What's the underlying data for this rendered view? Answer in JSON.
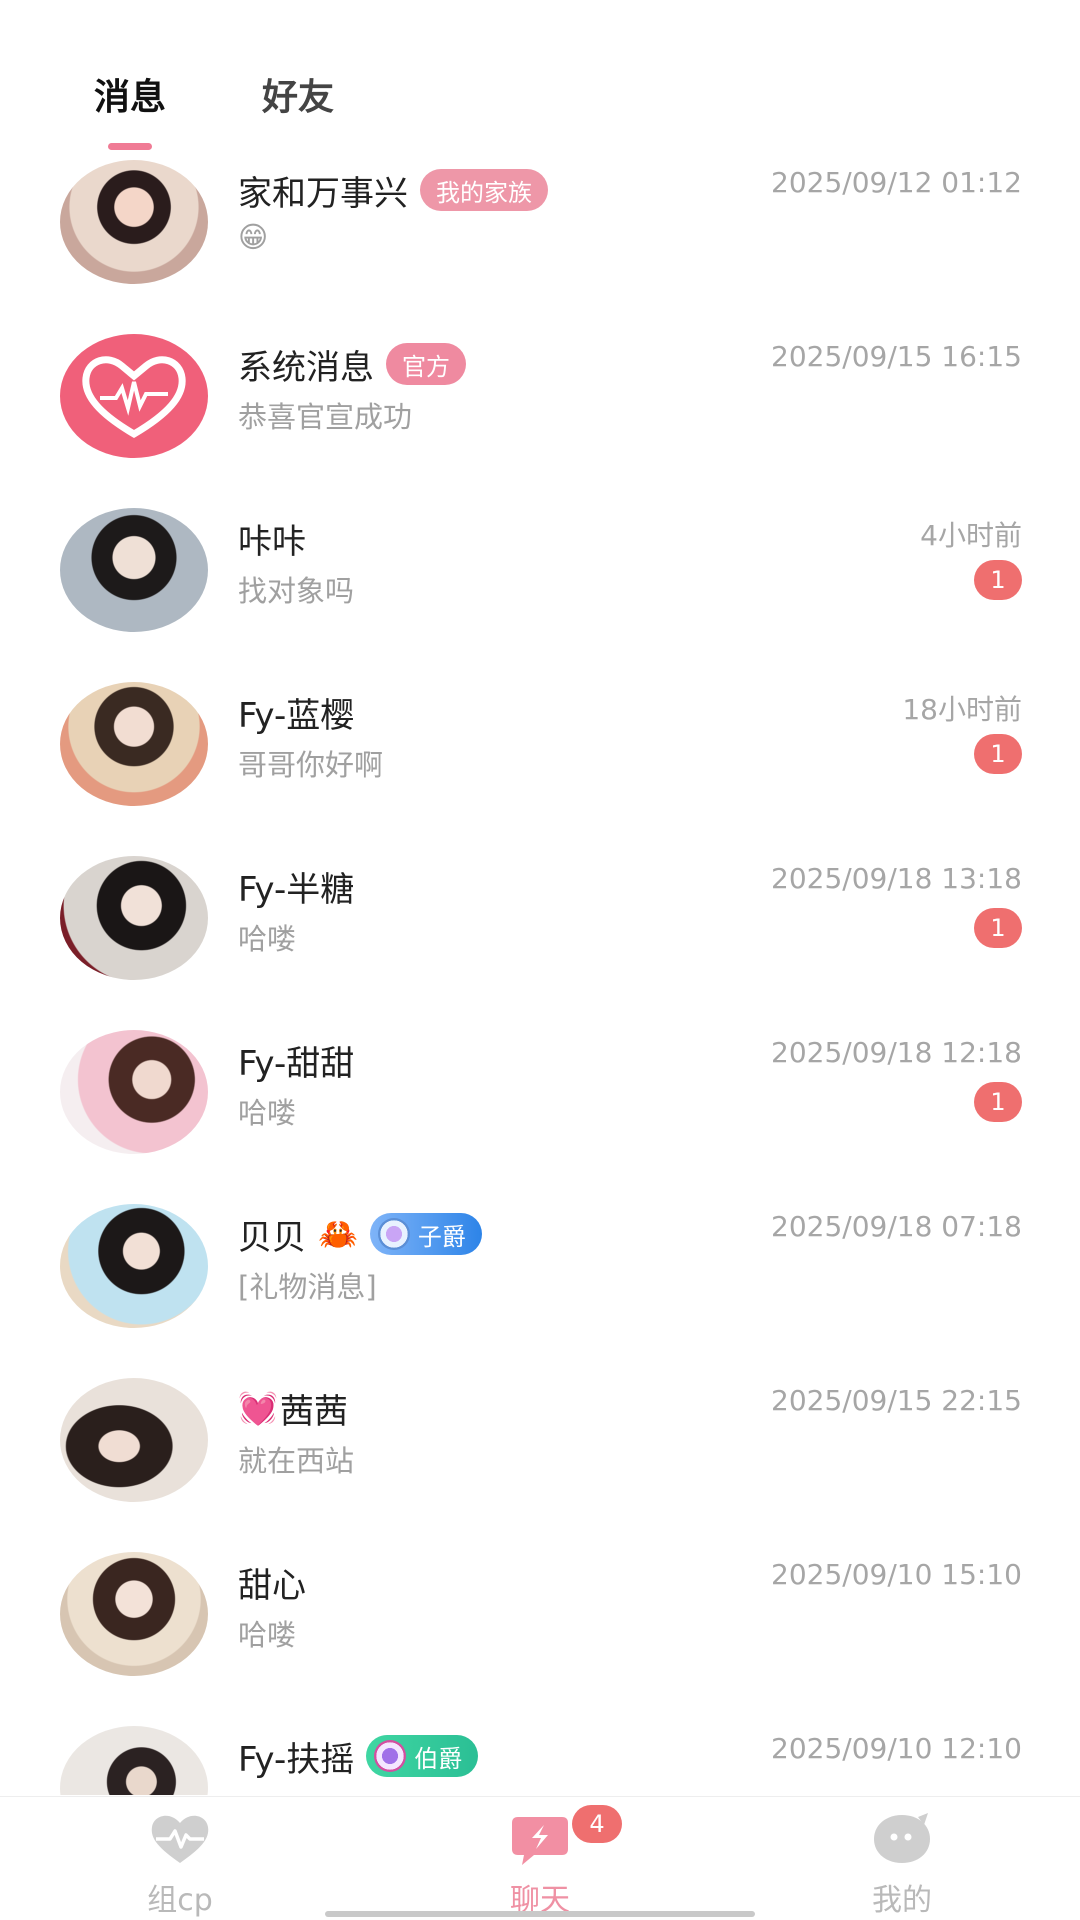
{
  "tabs": [
    {
      "label": "消息",
      "active": true
    },
    {
      "label": "好友",
      "active": false
    }
  ],
  "conversations": [
    {
      "name": "家和万事兴",
      "badge": "我的家族",
      "time": "2025/09/12 01:12",
      "preview": "😁",
      "unread": ""
    },
    {
      "name": "系统消息",
      "badge": "官方",
      "time": "2025/09/15 16:15",
      "preview": "恭喜官宣成功",
      "unread": ""
    },
    {
      "name": "咔咔",
      "time": "4小时前",
      "preview": "找对象吗",
      "unread": "1"
    },
    {
      "name": "Fy-蓝樱",
      "time": "18小时前",
      "preview": "哥哥你好啊",
      "unread": "1"
    },
    {
      "name": "Fy-半糖",
      "time": "2025/09/18 13:18",
      "preview": "哈喽",
      "unread": "1"
    },
    {
      "name": "Fy-甜甜",
      "time": "2025/09/18 12:18",
      "preview": "哈喽",
      "unread": "1"
    },
    {
      "name": "贝贝",
      "name_emoji": "🦀",
      "badge": "子爵",
      "time": "2025/09/18 07:18",
      "preview": "[礼物消息]",
      "unread": ""
    },
    {
      "name_emoji": "💓",
      "name": "茜茜",
      "time": "2025/09/15 22:15",
      "preview": "就在西站",
      "unread": ""
    },
    {
      "name": "甜心",
      "time": "2025/09/10 15:10",
      "preview": "哈喽",
      "unread": ""
    },
    {
      "name": "Fy-扶摇",
      "badge": "伯爵",
      "time": "2025/09/10 12:10",
      "preview": "",
      "unread": ""
    }
  ],
  "bottom_nav": [
    {
      "label": "组cp",
      "icon": "heartbeat-icon"
    },
    {
      "label": "聊天",
      "icon": "chat-bubble-icon",
      "badge": "4",
      "active": true
    },
    {
      "label": "我的",
      "icon": "ghost-face-icon"
    }
  ],
  "colors": {
    "accent": "#ef91a4",
    "unread_badge": "#ef6f6f",
    "muted_text": "#a6a6a6",
    "system_avatar": "#f0607a"
  }
}
